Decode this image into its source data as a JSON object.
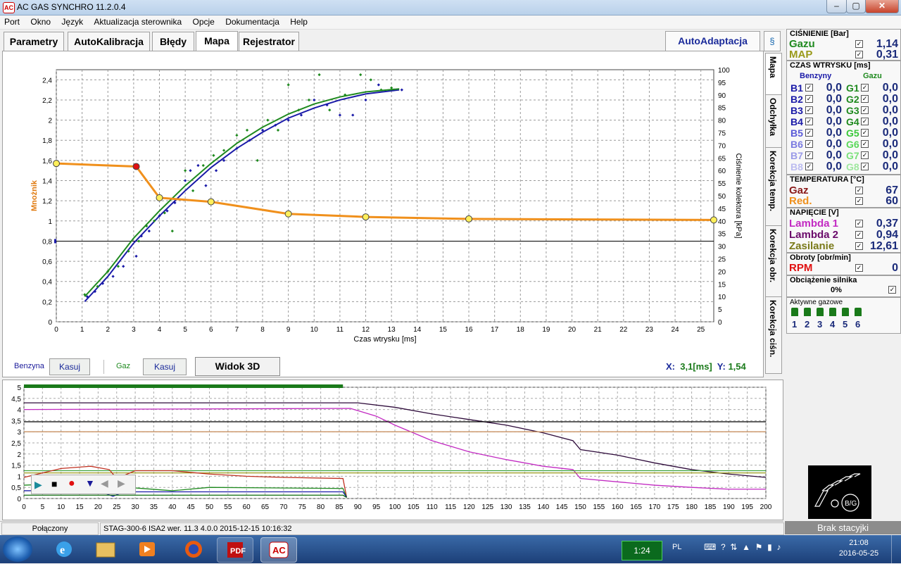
{
  "window": {
    "title": "AC GAS SYNCHRO  11.2.0.4",
    "app_icon": "AC"
  },
  "menu": [
    "Port",
    "Okno",
    "Język",
    "Aktualizacja sterownika",
    "Opcje",
    "Dokumentacja",
    "Help"
  ],
  "tabs": [
    "Parametry",
    "AutoKalibracja",
    "Błędy",
    "Mapa",
    "Rejestrator"
  ],
  "autoadapt_label": "AutoAdaptacja",
  "side_tabs": [
    "Mapa",
    "Odchyłka",
    "Korekcja temp.",
    "Korekcja obr.",
    "Korekcja ciśn."
  ],
  "chart_data": [
    {
      "type": "scatter",
      "xlabel": "Czas wtrysku [ms]",
      "ylabel": "Mnożnik",
      "y2label": "Ciśnienie kolektora [kPa]",
      "xlim": [
        0,
        25.5
      ],
      "ylim": [
        0,
        2.5
      ],
      "y2lim": [
        0,
        100
      ],
      "x_ticks": [
        0,
        1,
        2,
        3,
        4,
        5,
        6,
        7,
        8,
        9,
        10,
        11,
        12,
        13,
        14,
        15,
        16,
        17,
        18,
        19,
        20,
        21,
        22,
        23,
        24,
        25
      ],
      "y_ticks": [
        "0",
        "0,2",
        "0,4",
        "0,6",
        "0,8",
        "1",
        "1,2",
        "1,4",
        "1,6",
        "1,8",
        "2",
        "2,2",
        "2,4"
      ],
      "y2_ticks": [
        0,
        5,
        10,
        15,
        20,
        25,
        30,
        35,
        40,
        45,
        50,
        55,
        60,
        65,
        70,
        75,
        80,
        85,
        90,
        95,
        100
      ],
      "grid": true,
      "multiplier_line": {
        "color": "#f0901c",
        "points": [
          [
            0,
            1.57
          ],
          [
            3.1,
            1.54
          ],
          [
            4,
            1.23
          ],
          [
            6,
            1.19
          ],
          [
            9,
            1.07
          ],
          [
            12,
            1.04
          ],
          [
            16,
            1.02
          ],
          [
            25.5,
            1.01
          ]
        ],
        "markers": [
          [
            0,
            1.57
          ],
          [
            3.1,
            1.54
          ],
          [
            4,
            1.23
          ],
          [
            6,
            1.19
          ],
          [
            9,
            1.07
          ],
          [
            12,
            1.04
          ],
          [
            16,
            1.02
          ],
          [
            25.5,
            1.01
          ]
        ],
        "selected_marker": 1
      },
      "reference_line_y": 0.8,
      "series": [
        {
          "name": "Benzyna",
          "color": "#1a1aa8",
          "curve": [
            [
              1.1,
              0.2
            ],
            [
              2,
              0.45
            ],
            [
              3,
              0.78
            ],
            [
              4,
              1.05
            ],
            [
              5,
              1.3
            ],
            [
              6,
              1.53
            ],
            [
              7,
              1.72
            ],
            [
              8,
              1.88
            ],
            [
              9,
              2.02
            ],
            [
              10,
              2.12
            ],
            [
              11,
              2.2
            ],
            [
              12,
              2.26
            ],
            [
              13.3,
              2.3
            ]
          ],
          "points": [
            [
              1.2,
              0.25
            ],
            [
              1.5,
              0.3
            ],
            [
              1.8,
              0.38
            ],
            [
              2.2,
              0.45
            ],
            [
              2.6,
              0.55
            ],
            [
              3.1,
              0.65
            ],
            [
              3.3,
              0.85
            ],
            [
              3.6,
              0.9
            ],
            [
              4,
              1.05
            ],
            [
              4.3,
              1.1
            ],
            [
              4.6,
              1.18
            ],
            [
              5,
              1.4
            ],
            [
              5.2,
              1.5
            ],
            [
              5.5,
              1.55
            ],
            [
              5.8,
              1.35
            ],
            [
              6.2,
              1.5
            ],
            [
              6.5,
              1.6
            ],
            [
              7,
              1.72
            ],
            [
              7.5,
              1.8
            ],
            [
              8,
              1.9
            ],
            [
              8.5,
              1.95
            ],
            [
              9,
              2.0
            ],
            [
              9.5,
              2.05
            ],
            [
              10,
              2.2
            ],
            [
              10.5,
              2.15
            ],
            [
              11,
              2.05
            ],
            [
              11.5,
              2.05
            ],
            [
              12,
              2.2
            ],
            [
              12.5,
              2.35
            ],
            [
              13.1,
              2.3
            ],
            [
              13.4,
              2.3
            ]
          ]
        },
        {
          "name": "Gaz",
          "color": "#1f8a1f",
          "curve": [
            [
              1.1,
              0.25
            ],
            [
              2,
              0.5
            ],
            [
              3,
              0.83
            ],
            [
              4,
              1.1
            ],
            [
              5,
              1.35
            ],
            [
              6,
              1.57
            ],
            [
              7,
              1.77
            ],
            [
              8,
              1.93
            ],
            [
              9,
              2.06
            ],
            [
              10,
              2.16
            ],
            [
              11,
              2.23
            ],
            [
              12,
              2.28
            ],
            [
              13.3,
              2.31
            ]
          ],
          "points": [
            [
              1.1,
              0.27
            ],
            [
              1.6,
              0.35
            ],
            [
              2,
              0.5
            ],
            [
              2.4,
              0.55
            ],
            [
              2.8,
              0.7
            ],
            [
              3.2,
              0.8
            ],
            [
              3.5,
              0.95
            ],
            [
              3.8,
              1.0
            ],
            [
              4.2,
              1.08
            ],
            [
              4.5,
              0.9
            ],
            [
              5,
              1.5
            ],
            [
              5.3,
              1.3
            ],
            [
              5.7,
              1.55
            ],
            [
              6.1,
              1.65
            ],
            [
              6.5,
              1.7
            ],
            [
              7,
              1.85
            ],
            [
              7.4,
              1.9
            ],
            [
              7.8,
              1.6
            ],
            [
              8.2,
              2.0
            ],
            [
              8.6,
              1.9
            ],
            [
              9,
              2.35
            ],
            [
              9.4,
              2.1
            ],
            [
              9.8,
              2.2
            ],
            [
              10.2,
              2.45
            ],
            [
              10.6,
              2.1
            ],
            [
              11.2,
              2.25
            ],
            [
              11.8,
              2.45
            ],
            [
              12.2,
              2.4
            ],
            [
              12.6,
              2.3
            ],
            [
              13,
              2.32
            ]
          ]
        }
      ]
    },
    {
      "type": "line",
      "xlim": [
        0,
        200
      ],
      "ylim": [
        0,
        5
      ],
      "x_ticks": [
        0,
        5,
        10,
        15,
        20,
        25,
        30,
        35,
        40,
        45,
        50,
        55,
        60,
        65,
        70,
        75,
        80,
        85,
        90,
        95,
        100,
        105,
        110,
        115,
        120,
        125,
        130,
        135,
        140,
        145,
        150,
        155,
        160,
        165,
        170,
        175,
        180,
        185,
        190,
        195,
        200
      ],
      "y_ticks": [
        "0",
        "0,5",
        "1",
        "1,5",
        "2",
        "2,5",
        "3",
        "3,5",
        "4",
        "4,5",
        "5"
      ],
      "grid": true,
      "series": [
        {
          "color": "#2d0a3a",
          "points": [
            [
              0,
              4.3
            ],
            [
              90,
              4.3
            ],
            [
              100,
              4.1
            ],
            [
              110,
              3.8
            ],
            [
              120,
              3.55
            ],
            [
              130,
              3.3
            ],
            [
              140,
              2.95
            ],
            [
              148,
              2.6
            ],
            [
              150,
              2.2
            ],
            [
              160,
              1.95
            ],
            [
              170,
              1.6
            ],
            [
              180,
              1.3
            ],
            [
              190,
              1.1
            ],
            [
              200,
              0.95
            ]
          ]
        },
        {
          "color": "#c22ac2",
          "points": [
            [
              0,
              4.0
            ],
            [
              88,
              4.05
            ],
            [
              95,
              3.7
            ],
            [
              100,
              3.3
            ],
            [
              110,
              2.6
            ],
            [
              120,
              2.1
            ],
            [
              130,
              1.75
            ],
            [
              140,
              1.45
            ],
            [
              148,
              1.3
            ],
            [
              150,
              0.9
            ],
            [
              160,
              0.75
            ],
            [
              170,
              0.6
            ],
            [
              180,
              0.5
            ],
            [
              190,
              0.42
            ],
            [
              200,
              0.42
            ]
          ]
        },
        {
          "color": "#000000",
          "points": [
            [
              0,
              3.45
            ],
            [
              200,
              3.45
            ]
          ]
        },
        {
          "color": "#c89060",
          "points": [
            [
              0,
              3.0
            ],
            [
              200,
              3.0
            ]
          ]
        },
        {
          "color": "#3aa03a",
          "points": [
            [
              0,
              1.25
            ],
            [
              200,
              1.25
            ]
          ]
        },
        {
          "color": "#9a9a1a",
          "points": [
            [
              0,
              1.15
            ],
            [
              200,
              1.15
            ]
          ]
        },
        {
          "color": "#c03020",
          "points": [
            [
              0,
              0.95
            ],
            [
              10,
              1.35
            ],
            [
              18,
              1.45
            ],
            [
              23,
              1.3
            ],
            [
              25,
              0.9
            ],
            [
              30,
              1.25
            ],
            [
              40,
              1.25
            ],
            [
              50,
              1.1
            ],
            [
              60,
              1.0
            ],
            [
              70,
              0.95
            ],
            [
              86,
              0.9
            ],
            [
              87,
              0.05
            ]
          ]
        },
        {
          "color": "#1f8a1f",
          "points": [
            [
              0,
              0.6
            ],
            [
              15,
              0.7
            ],
            [
              24,
              0.65
            ],
            [
              28,
              0.5
            ],
            [
              40,
              0.35
            ],
            [
              50,
              0.5
            ],
            [
              86,
              0.45
            ],
            [
              87,
              0.05
            ]
          ]
        },
        {
          "color": "#1a1aa8",
          "points": [
            [
              0,
              0.35
            ],
            [
              20,
              0.35
            ],
            [
              24,
              0.1
            ],
            [
              27,
              0.3
            ],
            [
              86,
              0.3
            ],
            [
              87,
              0.05
            ]
          ]
        },
        {
          "color": "#0a6a0a",
          "points": [
            [
              0,
              0.15
            ],
            [
              86,
              0.15
            ],
            [
              87,
              0.05
            ]
          ]
        }
      ],
      "progress_bar": {
        "color": "#1a7a1a",
        "fraction": 0.43
      }
    }
  ],
  "controls": {
    "benzyna_label": "Benzyna",
    "kasuj1": "Kasuj",
    "gaz_label": "Gaz",
    "kasuj2": "Kasuj",
    "widok3d": "Widok 3D",
    "xy_x_label": "X:",
    "xy_x_value": "3,1[ms]",
    "xy_y_label": "Y:",
    "xy_y_value": "1,54"
  },
  "right_panel": {
    "cisnienie": {
      "title": "CIŚNIENIE [Bar]",
      "gazu_label": "Gazu",
      "gazu_value": "1,14",
      "map_label": "MAP",
      "map_value": "0,31"
    },
    "czas": {
      "title": "CZAS WTRYSKU  [ms]",
      "benzyny": "Benzyny",
      "gazu": "Gazu",
      "rows": [
        {
          "b": "B1",
          "bv": "0,0",
          "g": "G1",
          "gv": "0,0"
        },
        {
          "b": "B2",
          "bv": "0,0",
          "g": "G2",
          "gv": "0,0"
        },
        {
          "b": "B3",
          "bv": "0,0",
          "g": "G3",
          "gv": "0,0"
        },
        {
          "b": "B4",
          "bv": "0,0",
          "g": "G4",
          "gv": "0,0"
        },
        {
          "b": "B5",
          "bv": "0,0",
          "g": "G5",
          "gv": "0,0"
        },
        {
          "b": "B6",
          "bv": "0,0",
          "g": "G6",
          "gv": "0,0"
        },
        {
          "b": "B7",
          "bv": "0,0",
          "g": "G7",
          "gv": "0,0"
        },
        {
          "b": "B8",
          "bv": "0,0",
          "g": "G8",
          "gv": "0,0"
        }
      ]
    },
    "temperatura": {
      "title": "TEMPERATURA  [°C]",
      "gaz_label": "Gaz",
      "gaz_value": "67",
      "red_label": "Red.",
      "red_value": "60"
    },
    "napiecie": {
      "title": "NAPIĘCIE [V]",
      "l1_label": "Lambda 1",
      "l1_value": "0,37",
      "l2_label": "Lambda 2",
      "l2_value": "0,94",
      "zas_label": "Zasilanie",
      "zas_value": "12,61"
    },
    "obroty": {
      "title": "Obroty [obr/min]",
      "rpm_label": "RPM",
      "rpm_value": "0"
    },
    "obciazenie": {
      "title": "Obciążenie silnika",
      "value": "0%"
    },
    "aktywne": {
      "title": "Aktywne gazowe",
      "nums": [
        "1",
        "2",
        "3",
        "4",
        "5",
        "6"
      ]
    }
  },
  "status": {
    "connected": "Połączony",
    "device": "STAG-300-6 ISA2  wer. 11.3  4.0.0   2015-12-15 10:16:32",
    "station": "Brak stacyjki"
  },
  "taskbar": {
    "timer": "1:24",
    "lang": "PL",
    "time": "21:08",
    "date": "2016-05-25"
  },
  "checkmark": "✓"
}
